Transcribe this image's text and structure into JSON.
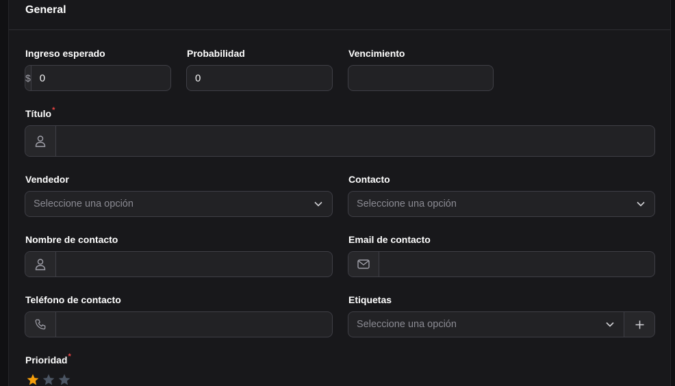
{
  "section": {
    "title": "General"
  },
  "fields": {
    "ingreso": {
      "label": "Ingreso esperado",
      "prefix": "$",
      "value": "0"
    },
    "probabilidad": {
      "label": "Probabilidad",
      "value": "0",
      "suffix": "%"
    },
    "vencimiento": {
      "label": "Vencimiento",
      "value": ""
    },
    "titulo": {
      "label": "Título",
      "required_mark": "*",
      "value": "",
      "icon": "user-icon"
    },
    "vendedor": {
      "label": "Vendedor",
      "placeholder": "Seleccione una opción"
    },
    "contacto": {
      "label": "Contacto",
      "placeholder": "Seleccione una opción"
    },
    "nombre_contacto": {
      "label": "Nombre de contacto",
      "value": "",
      "icon": "user-icon"
    },
    "email_contacto": {
      "label": "Email de contacto",
      "value": "",
      "icon": "mail-icon"
    },
    "telefono_contacto": {
      "label": "Teléfono de contacto",
      "value": "",
      "icon": "phone-icon"
    },
    "etiquetas": {
      "label": "Etiquetas",
      "placeholder": "Seleccione una opción",
      "add_icon": "plus-icon"
    },
    "prioridad": {
      "label": "Prioridad",
      "required_mark": "*",
      "rating": 1,
      "max": 3
    }
  },
  "colors": {
    "accent_star": "#f59e0b",
    "inactive_star": "#4b5563",
    "required": "#ef4444"
  }
}
